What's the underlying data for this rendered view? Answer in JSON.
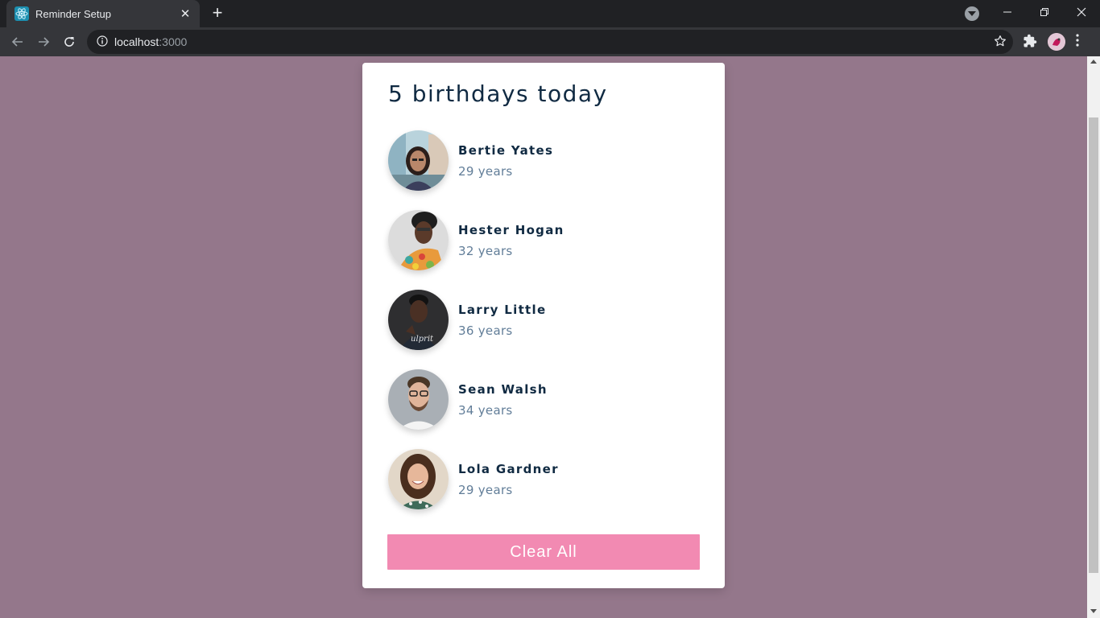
{
  "browser": {
    "tab_title": "Reminder Setup",
    "url_host": "localhost",
    "url_port": ":3000"
  },
  "app": {
    "heading": "5 birthdays today",
    "people": [
      {
        "name": "Bertie Yates",
        "age": "29 years"
      },
      {
        "name": "Hester Hogan",
        "age": "32 years"
      },
      {
        "name": "Larry Little",
        "age": "36 years"
      },
      {
        "name": "Sean Walsh",
        "age": "34 years"
      },
      {
        "name": "Lola Gardner",
        "age": "29 years"
      }
    ],
    "clear_label": "Clear All"
  },
  "colors": {
    "page_background": "#94778b",
    "heading_text": "#102a42",
    "age_text": "#617d98",
    "button": "#f28ab2"
  }
}
